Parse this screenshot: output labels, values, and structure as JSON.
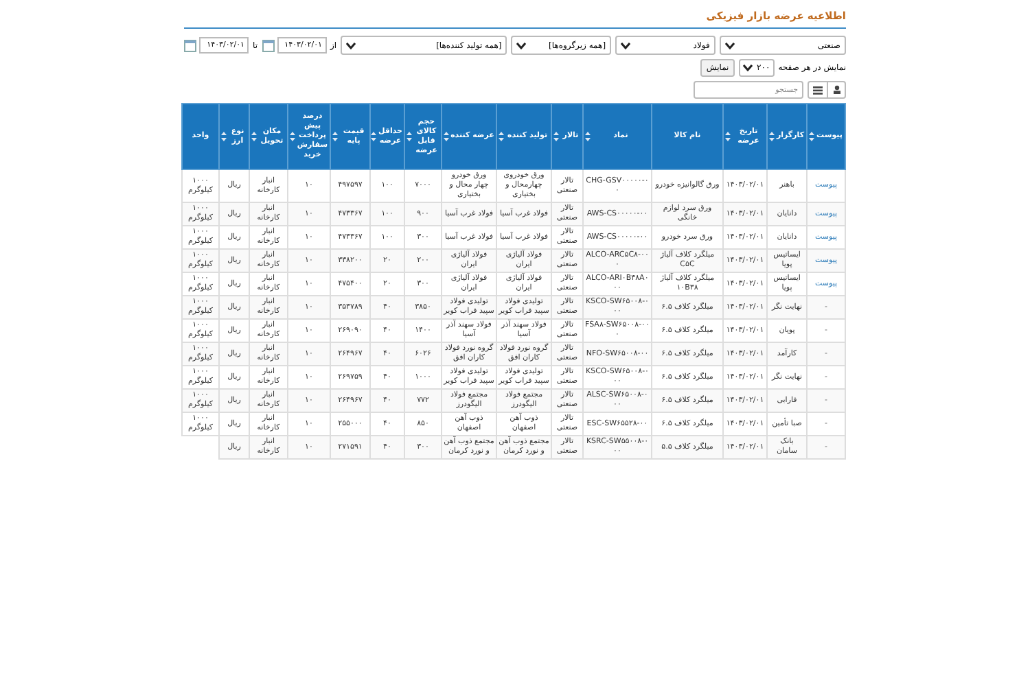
{
  "title": "اطلاعیه عرضه بازار فیزیکی",
  "filters": [
    {
      "kind": "select",
      "value": "صنعتی"
    },
    {
      "kind": "select",
      "value": "فولاد"
    },
    {
      "kind": "select",
      "value": "[همه زیرگروه‌ها]"
    },
    {
      "kind": "select",
      "value": "[همه تولید کننده‌ها]"
    },
    {
      "kind": "label",
      "value": "از"
    },
    {
      "kind": "date",
      "value": "۱۴۰۳/۰۲/۰۱"
    },
    {
      "kind": "label",
      "value": "تا"
    },
    {
      "kind": "date",
      "value": "۱۴۰۳/۰۲/۰۱"
    }
  ],
  "page_size": {
    "label": "نمایش در هر صفحه",
    "value": "۲۰۰",
    "button": "نمایش"
  },
  "search": {
    "placeholder": "جستجو"
  },
  "columns": [
    {
      "label": "پیوست",
      "sortable": true
    },
    {
      "label": "کارگزار",
      "sortable": true
    },
    {
      "label": "تاریخ عرضه",
      "sortable": true
    },
    {
      "label": "نام کالا",
      "sortable": false
    },
    {
      "label": "نماد",
      "sortable": true
    },
    {
      "label": "تالار",
      "sortable": true
    },
    {
      "label": "تولید کننده",
      "sortable": true
    },
    {
      "label": "عرضه کننده",
      "sortable": true
    },
    {
      "label": "حجم کالای قابل عرضه",
      "sortable": true
    },
    {
      "label": "حداقل عرضه",
      "sortable": true
    },
    {
      "label": "قیمت پایه",
      "sortable": true
    },
    {
      "label": "درصد پیش پرداخت سفارش خرید",
      "sortable": true
    },
    {
      "label": "مکان تحویل",
      "sortable": true
    },
    {
      "label": "نوع ارز",
      "sortable": true
    },
    {
      "label": "واحد",
      "sortable": false
    }
  ],
  "rows": [
    {
      "attachment": {
        "kind": "link",
        "text": "پیوست"
      },
      "cells": [
        "باهنر",
        "۱۴۰۳/۰۲/۰۱",
        "ورق گالوانیزه خودرو",
        "CHG-GSV۰۰۰۰۰-۰۰",
        "تالار صنعتی",
        "ورق خودروی چهارمحال و بختیاری",
        "ورق خودرو چهار محال و بختیاری",
        "۷۰۰۰",
        "۱۰۰",
        "۴۹۷۵۹۷",
        "۱۰",
        "انبار کارخانه",
        "ریال",
        "۱۰۰۰ کیلوگرم"
      ]
    },
    {
      "attachment": {
        "kind": "link",
        "text": "پیوست"
      },
      "cells": [
        "دانایان",
        "۱۴۰۳/۰۲/۰۱",
        "ورق سرد لوازم خانگی",
        "AWS-CS۰۰۰۰۰-۰۰",
        "تالار صنعتی",
        "فولاد غرب آسیا",
        "فولاد غرب آسیا",
        "۹۰۰",
        "۱۰۰",
        "۴۷۳۳۶۷",
        "۱۰",
        "انبار کارخانه",
        "ریال",
        "۱۰۰۰ کیلوگرم"
      ]
    },
    {
      "attachment": {
        "kind": "link",
        "text": "پیوست"
      },
      "cells": [
        "دانایان",
        "۱۴۰۳/۰۲/۰۱",
        "ورق سرد خودرو",
        "AWS-CS۰۰۰۰۰-۰۰",
        "تالار صنعتی",
        "فولاد غرب آسیا",
        "فولاد غرب آسیا",
        "۳۰۰",
        "۱۰۰",
        "۴۷۳۳۶۷",
        "۱۰",
        "انبار کارخانه",
        "ریال",
        "۱۰۰۰ کیلوگرم"
      ]
    },
    {
      "attachment": {
        "kind": "link",
        "text": "پیوست"
      },
      "cells": [
        "ایساتیس پویا",
        "۱۴۰۳/۰۲/۰۱",
        "میلگرد کلاف آلیاژ C۵C",
        "ALCO-ARC۵C۸-۰۰۰",
        "تالار صنعتی",
        "فولاد آلیاژی ایران",
        "فولاد آلیاژی ایران",
        "۲۰۰",
        "۲۰",
        "۳۳۸۲۰۰",
        "۱۰",
        "انبار کارخانه",
        "ریال",
        "۱۰۰۰ کیلوگرم"
      ]
    },
    {
      "attachment": {
        "kind": "link",
        "text": "پیوست"
      },
      "cells": [
        "ایساتیس پویا",
        "۱۴۰۳/۰۲/۰۱",
        "میلگرد کلاف آلیاژ ۱۰B۳۸",
        "ALCO-ARI۰B۳۸A۰۰۰",
        "تالار صنعتی",
        "فولاد آلیاژی ایران",
        "فولاد آلیاژی ایران",
        "۳۰۰",
        "۲۰",
        "۴۷۵۴۰۰",
        "۱۰",
        "انبار کارخانه",
        "ریال",
        "۱۰۰۰ کیلوگرم"
      ]
    },
    {
      "attachment": {
        "kind": "none",
        "text": "-"
      },
      "cells": [
        "نهایت نگر",
        "۱۴۰۳/۰۲/۰۱",
        "میلگرد کلاف ۶.۵",
        "KSCO-SW۶۵۰۰۸-۰۰۰",
        "تالار صنعتی",
        "تولیدی فولاد سپید فراب کویر",
        "تولیدی فولاد سپید فراب کویر",
        "۳۸۵۰",
        "۴۰",
        "۳۵۳۷۸۹",
        "۱۰",
        "انبار کارخانه",
        "ریال",
        "۱۰۰۰ کیلوگرم"
      ]
    },
    {
      "attachment": {
        "kind": "none",
        "text": "-"
      },
      "cells": [
        "پویان",
        "۱۴۰۳/۰۲/۰۱",
        "میلگرد کلاف ۶.۵",
        "FSA۸-SW۶۵۰۰۸-۰۰۰",
        "تالار صنعتی",
        "فولاد سهند آذر آسیا",
        "فولاد سهند آذر آسیا",
        "۱۴۰۰",
        "۴۰",
        "۲۶۹۰۹۰",
        "۱۰",
        "انبار کارخانه",
        "ریال",
        "۱۰۰۰ کیلوگرم"
      ]
    },
    {
      "attachment": {
        "kind": "none",
        "text": "-"
      },
      "cells": [
        "کارآمد",
        "۱۴۰۳/۰۲/۰۱",
        "میلگرد کلاف ۶.۵",
        "NFO-SW۶۵۰۰۸-۰۰",
        "تالار صنعتی",
        "گروه نورد فولاد کاران افق",
        "گروه نورد فولاد کاران افق",
        "۶۰۲۶",
        "۴۰",
        "۲۶۴۹۶۷",
        "۱۰",
        "انبار کارخانه",
        "ریال",
        "۱۰۰۰ کیلوگرم"
      ]
    },
    {
      "attachment": {
        "kind": "none",
        "text": "-"
      },
      "cells": [
        "نهایت نگر",
        "۱۴۰۳/۰۲/۰۱",
        "میلگرد کلاف ۶.۵",
        "KSCO-SW۶۵۰۰۸-۰۰۰",
        "تالار صنعتی",
        "تولیدی فولاد سپید فراب کویر",
        "تولیدی فولاد سپید فراب کویر",
        "۱۰۰۰",
        "۴۰",
        "۲۶۹۷۵۹",
        "۱۰",
        "انبار کارخانه",
        "ریال",
        "۱۰۰۰ کیلوگرم"
      ]
    },
    {
      "attachment": {
        "kind": "none",
        "text": "-"
      },
      "cells": [
        "فارابی",
        "۱۴۰۳/۰۲/۰۱",
        "میلگرد کلاف ۶.۵",
        "ALSC-SW۶۵۰۰۸-۰۰۰",
        "تالار صنعتی",
        "مجتمع فولاد الیگودرز",
        "مجتمع فولاد الیگودرز",
        "۷۷۲",
        "۴۰",
        "۲۶۴۹۶۷",
        "۱۰",
        "انبار کارخانه",
        "ریال",
        "۱۰۰۰ کیلوگرم"
      ]
    },
    {
      "attachment": {
        "kind": "none",
        "text": "-"
      },
      "cells": [
        "صبا تأمین",
        "۱۴۰۳/۰۲/۰۱",
        "میلگرد کلاف ۶.۵",
        "ESC-SW۶۵۵۲۸-۰۰",
        "تالار صنعتی",
        "ذوب آهن اصفهان",
        "ذوب آهن اصفهان",
        "۸۵۰",
        "۴۰",
        "۲۵۵۰۰۰",
        "۱۰",
        "انبار کارخانه",
        "ریال",
        "۱۰۰۰ کیلوگرم"
      ]
    },
    {
      "attachment": {
        "kind": "none",
        "text": "-"
      },
      "cells": [
        "بانک سامان",
        "۱۴۰۳/۰۲/۰۱",
        "میلگرد کلاف ۵.۵",
        "KSRC-SW۵۵۰۰۸-۰۰۰",
        "تالار صنعتی",
        "مجتمع ذوب آهن و نورد کرمان",
        "مجتمع ذوب آهن و نورد کرمان",
        "۳۰۰",
        "۴۰",
        "۲۷۱۵۹۱",
        "۱۰",
        "انبار کارخانه",
        "ریال"
      ]
    }
  ]
}
